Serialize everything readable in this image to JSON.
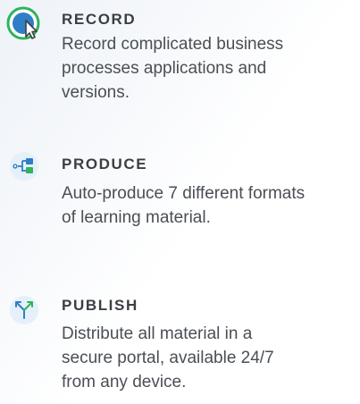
{
  "features": [
    {
      "icon": "record-cursor-icon",
      "title": "RECORD",
      "lines": [
        "Record complicated business",
        "processes applications and",
        "versions."
      ]
    },
    {
      "icon": "produce-flow-icon",
      "title": "PRODUCE",
      "lines": [
        "Auto-produce 7 different formats",
        "of learning material."
      ]
    },
    {
      "icon": "publish-distribute-icon",
      "title": "PUBLISH",
      "lines": [
        "Distribute all material in a",
        "secure portal, available 24/7",
        "from any device."
      ]
    }
  ],
  "colors": {
    "accent_green": "#2fb35b",
    "accent_blue": "#2f7ec6",
    "icon_bg": "#e6f0fa"
  }
}
